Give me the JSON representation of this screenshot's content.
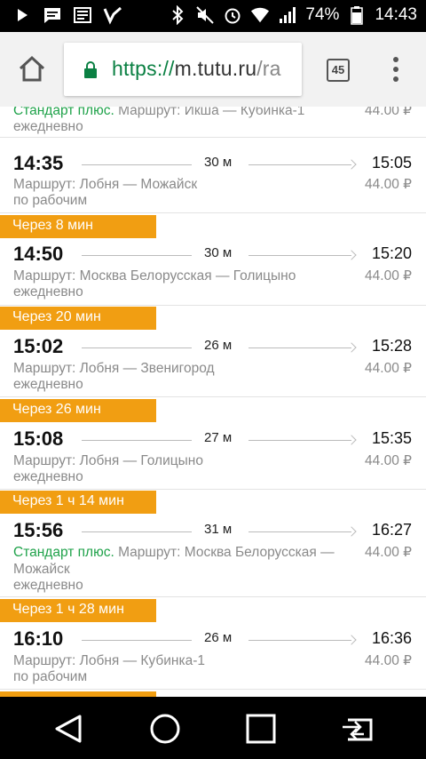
{
  "status_bar": {
    "battery_percent": "74%",
    "time": "14:43",
    "icons_left": [
      "play-store-icon",
      "message-icon",
      "news-icon",
      "check-icon"
    ],
    "icons_right": [
      "bluetooth-icon",
      "mute-icon",
      "alarm-icon",
      "wifi-icon",
      "signal-icon",
      "battery-icon"
    ]
  },
  "browser": {
    "url_scheme": "https://",
    "url_host": "m.tutu.ru",
    "url_path": "/ra",
    "tab_count": "45"
  },
  "top_partial": {
    "standard": "Стандарт плюс.",
    "route": "Маршрут: Икша — Кубинка-1",
    "days": "ежедневно",
    "price": "44.00 ₽"
  },
  "trains": [
    {
      "badge": "",
      "dep": "14:35",
      "arr": "15:05",
      "duration": "30 м",
      "standard": "",
      "route": "Маршрут: Лобня — Можайск",
      "days": "по рабочим",
      "price": "44.00 ₽"
    },
    {
      "badge": "Через 8 мин",
      "dep": "14:50",
      "arr": "15:20",
      "duration": "30 м",
      "standard": "",
      "route": "Маршрут: Москва Белорусская — Голицыно",
      "days": "ежедневно",
      "price": "44.00 ₽"
    },
    {
      "badge": "Через 20 мин",
      "dep": "15:02",
      "arr": "15:28",
      "duration": "26 м",
      "standard": "",
      "route": "Маршрут: Лобня — Звенигород",
      "days": "ежедневно",
      "price": "44.00 ₽"
    },
    {
      "badge": "Через 26 мин",
      "dep": "15:08",
      "arr": "15:35",
      "duration": "27 м",
      "standard": "",
      "route": "Маршрут: Лобня — Голицыно",
      "days": "ежедневно",
      "price": "44.00 ₽"
    },
    {
      "badge": "Через 1 ч 14 мин",
      "dep": "15:56",
      "arr": "16:27",
      "duration": "31 м",
      "standard": "Стандарт плюс.",
      "route": "Маршрут: Москва Белорусская —",
      "route2": "Можайск",
      "days": "ежедневно",
      "price": "44.00 ₽"
    },
    {
      "badge": "Через 1 ч 28 мин",
      "dep": "16:10",
      "arr": "16:36",
      "duration": "26 м",
      "standard": "",
      "route": "Маршрут: Лобня — Кубинка-1",
      "days": "по рабочим",
      "price": "44.00 ₽"
    }
  ],
  "colors": {
    "badge": "#f19e12",
    "standard_plus": "#1fa24a",
    "secure_scheme": "#0b8043"
  },
  "nav_bar": {
    "icons": [
      "back-icon",
      "home-circle-icon",
      "recents-icon",
      "screen-cast-icon"
    ]
  }
}
